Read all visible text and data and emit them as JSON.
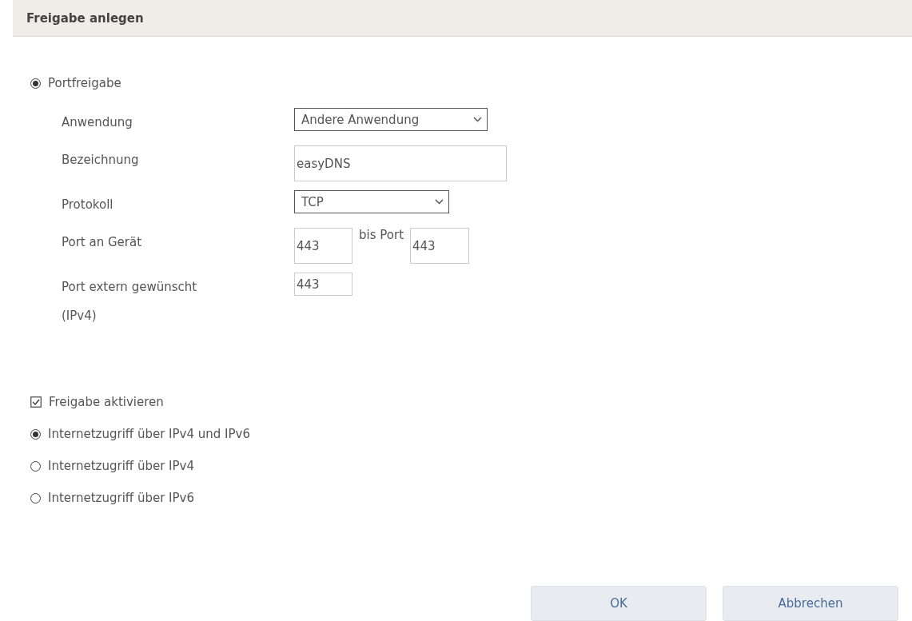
{
  "dialog": {
    "title": "Freigabe anlegen"
  },
  "share_type": {
    "label": "Portfreigabe",
    "selected": true
  },
  "fields": [
    {
      "kind": "select",
      "label": "Anwendung",
      "value": "Andere Anwendung"
    },
    {
      "kind": "text",
      "label": "Bezeichnung",
      "value": "easyDNS"
    },
    {
      "kind": "select",
      "label": "Protokoll",
      "value": "TCP"
    },
    {
      "kind": "range",
      "label": "Port an Gerät",
      "value": "443",
      "to_label": "bis Port",
      "to_value": "443"
    },
    {
      "kind": "text",
      "label": "Port extern gewünscht (IPv4)",
      "value": "443"
    }
  ],
  "options": [
    {
      "kind": "checkbox",
      "label": "Freigabe aktivieren",
      "checked": true
    },
    {
      "kind": "radio",
      "label": "Internetzugriff über IPv4 und IPv6",
      "selected": true
    },
    {
      "kind": "radio",
      "label": "Internetzugriff über IPv4",
      "selected": false
    },
    {
      "kind": "radio",
      "label": "Internetzugriff über IPv6",
      "selected": false
    }
  ],
  "buttons": [
    "OK",
    "Abbrechen"
  ]
}
